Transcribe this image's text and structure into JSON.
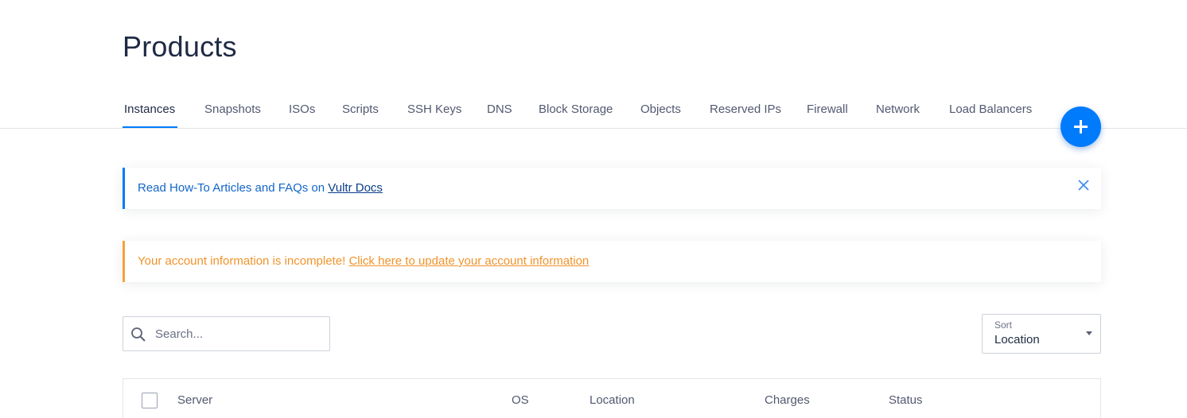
{
  "page": {
    "title": "Products"
  },
  "tabs": [
    {
      "label": "Instances",
      "active": true
    },
    {
      "label": "Snapshots"
    },
    {
      "label": "ISOs"
    },
    {
      "label": "Scripts"
    },
    {
      "label": "SSH Keys"
    },
    {
      "label": "DNS"
    },
    {
      "label": "Block Storage"
    },
    {
      "label": "Objects"
    },
    {
      "label": "Reserved IPs"
    },
    {
      "label": "Firewall"
    },
    {
      "label": "Network"
    },
    {
      "label": "Load Balancers"
    }
  ],
  "fab": {
    "icon": "plus-icon"
  },
  "notices": {
    "docs": {
      "text": "Read How-To Articles and FAQs on ",
      "link": "Vultr Docs",
      "close_icon": "close-icon"
    },
    "account": {
      "text": "Your account information is incomplete! ",
      "link": "Click here to update your account information"
    }
  },
  "search": {
    "placeholder": "Search...",
    "value": "",
    "icon": "search-icon"
  },
  "sort": {
    "label": "Sort",
    "value": "Location"
  },
  "table": {
    "columns": [
      "Server",
      "OS",
      "Location",
      "Charges",
      "Status"
    ]
  },
  "colors": {
    "accent": "#007bfc",
    "warning": "#f7a13b",
    "title": "#1f2a44"
  }
}
